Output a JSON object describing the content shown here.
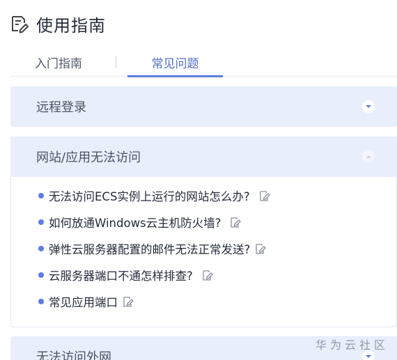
{
  "header": {
    "title": "使用指南",
    "icon": "doc-edit-icon"
  },
  "tabs": [
    {
      "label": "入门指南",
      "active": false
    },
    {
      "label": "常见问题",
      "active": true
    }
  ],
  "colors": {
    "accent": "#5e7ce0",
    "panel_bg": "#e9eefb",
    "text": "#252b3a"
  },
  "sections": [
    {
      "title": "远程登录",
      "expanded": false
    },
    {
      "title": "网站/应用无法访问",
      "expanded": true,
      "items": [
        {
          "label": "无法访问ECS实例上运行的网站怎么办?"
        },
        {
          "label": "如何放通Windows云主机防火墙?"
        },
        {
          "label": "弹性云服务器配置的邮件无法正常发送?"
        },
        {
          "label": "云服务器端口不通怎样排查?"
        },
        {
          "label": "常见应用端口"
        }
      ]
    },
    {
      "title": "无法访问外网",
      "expanded": false
    }
  ],
  "watermark": "华为云社区"
}
